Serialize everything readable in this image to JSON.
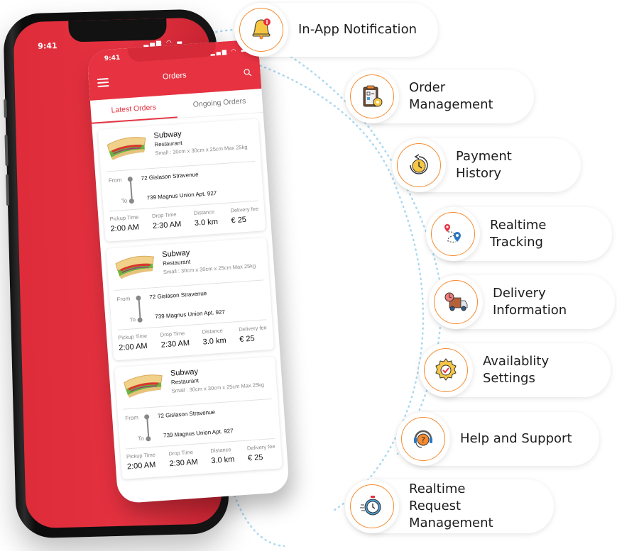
{
  "back_phone": {
    "time": "9:41",
    "status_icons": [
      "signal-icon",
      "wifi-icon",
      "battery-icon"
    ]
  },
  "app": {
    "time": "9:41",
    "title": "Orders",
    "menu_icon": "hamburger-menu-icon",
    "search_icon": "search-icon",
    "tabs": [
      {
        "label": "Latest Orders",
        "active": true
      },
      {
        "label": "Ongoing Orders",
        "active": false
      }
    ],
    "orders": [
      {
        "name": "Subway",
        "type": "Restaurant",
        "size": "Small : 30cm x 30cm x 25cm Max 25kg",
        "from_label": "From",
        "from": "72 Gislason Stravenue",
        "to_label": "To",
        "to": "739 Magnus Union Apt. 927",
        "stats": [
          {
            "label": "Pickup Time",
            "value": "2:00 AM"
          },
          {
            "label": "Drop Time",
            "value": "2:30 AM"
          },
          {
            "label": "Distance",
            "value": "3.0 km"
          },
          {
            "label": "Delivery fee",
            "value": "€ 25"
          }
        ]
      },
      {
        "name": "Subway",
        "type": "Restaurant",
        "size": "Small : 30cm x 30cm x 25cm Max 25kg",
        "from_label": "From",
        "from": "72 Gislason Stravenue",
        "to_label": "To",
        "to": "739 Magnus Union Apt. 927",
        "stats": [
          {
            "label": "Pickup Time",
            "value": "2:00 AM"
          },
          {
            "label": "Drop Time",
            "value": "2:30 AM"
          },
          {
            "label": "Distance",
            "value": "3.0 km"
          },
          {
            "label": "Delivery fee",
            "value": "€ 25"
          }
        ]
      },
      {
        "name": "Subway",
        "type": "Restaurant",
        "size": "Small : 30cm x 30cm x 25cm Max 25kg",
        "from_label": "From",
        "from": "72 Gislason Stravenue",
        "to_label": "To",
        "to": "739 Magnus Union Apt. 927",
        "stats": [
          {
            "label": "Pickup Time",
            "value": "2:00 AM"
          },
          {
            "label": "Drop Time",
            "value": "2:30 AM"
          },
          {
            "label": "Distance",
            "value": "3.0 km"
          },
          {
            "label": "Delivery fee",
            "value": "€ 25"
          }
        ]
      }
    ]
  },
  "features": [
    {
      "label": "In-App Notification",
      "icon": "bell-notification-icon"
    },
    {
      "label": "Order Management",
      "icon": "clipboard-gear-icon"
    },
    {
      "label": "Payment History",
      "icon": "clock-history-icon"
    },
    {
      "label": "Realtime Tracking",
      "icon": "map-pins-route-icon"
    },
    {
      "label": "Delivery Information",
      "icon": "delivery-truck-icon"
    },
    {
      "label": "Availablity Settings",
      "icon": "gear-check-icon"
    },
    {
      "label": "Help and Support",
      "icon": "headset-support-icon"
    },
    {
      "label": "Realtime Request Management",
      "icon": "stopwatch-icon"
    }
  ],
  "colors": {
    "brand_red": "#e63241",
    "accent_orange": "#f58a2e",
    "dotted_line": "#a9d8f0"
  }
}
